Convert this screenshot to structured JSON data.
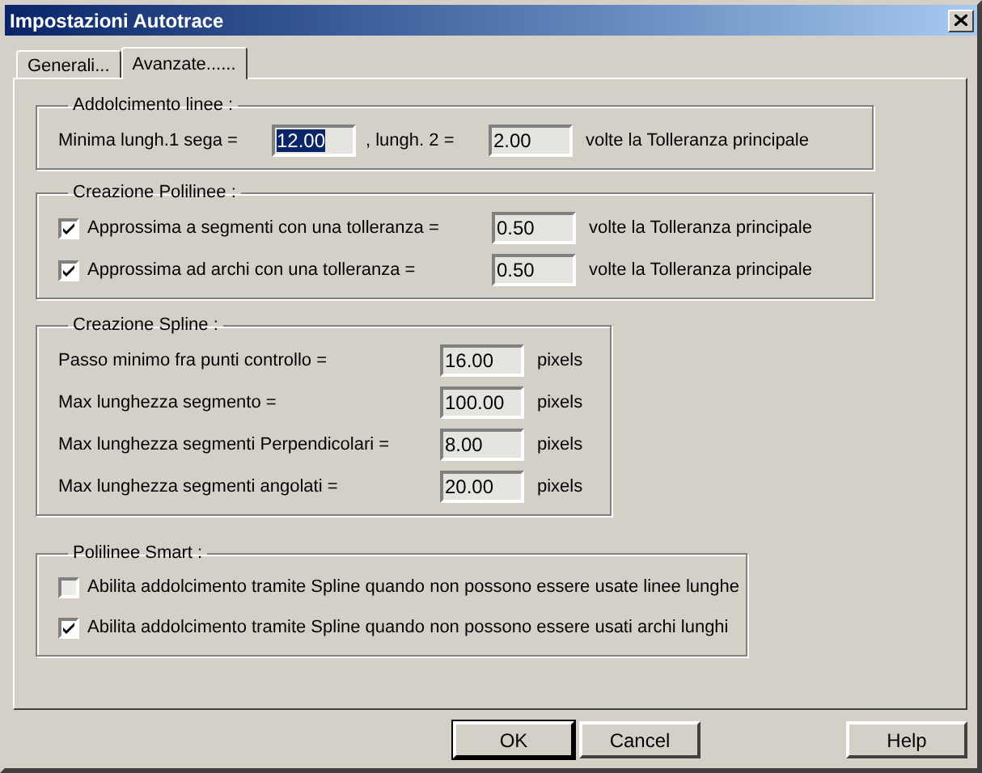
{
  "window": {
    "title": "Impostazioni Autotrace"
  },
  "tabs": [
    {
      "label": "Generali...",
      "selected": false
    },
    {
      "label": "Avanzate......",
      "selected": true
    }
  ],
  "groups": [
    {
      "title": "Addolcimento linee :",
      "rows": [
        {
          "kind": "pair",
          "label": "Minima lungh.1 sega =",
          "value": "12.00",
          "value_selected": true,
          "label_2": ", lungh. 2 =",
          "value_2": "2.00",
          "suffix": "volte la Tolleranza principale"
        }
      ]
    },
    {
      "title": "Creazione Polilinee :",
      "rows": [
        {
          "kind": "check_field",
          "label": "Approssima a segmenti con una tolleranza =",
          "checked": true,
          "value": "0.50",
          "suffix": "volte la Tolleranza principale"
        },
        {
          "kind": "check_field",
          "label": "Approssima ad archi con una tolleranza =",
          "checked": true,
          "value": "0.50",
          "suffix": "volte la Tolleranza principale"
        }
      ]
    },
    {
      "title": "Creazione Spline :",
      "rows": [
        {
          "kind": "field",
          "label": "Passo minimo fra punti controllo =",
          "value": "16.00",
          "suffix": "pixels"
        },
        {
          "kind": "field",
          "label": "Max lunghezza segmento =",
          "value": "100.00",
          "suffix": "pixels"
        },
        {
          "kind": "field",
          "label": "Max lunghezza segmenti Perpendicolari =",
          "value": "8.00",
          "suffix": "pixels"
        },
        {
          "kind": "field",
          "label": "Max lunghezza segmenti angolati =",
          "value": "20.00",
          "suffix": "pixels"
        }
      ]
    },
    {
      "title": "Polilinee Smart :",
      "rows": [
        {
          "kind": "check",
          "label": "Abilita addolcimento tramite Spline quando non possono essere usate linee lunghe",
          "checked": false
        },
        {
          "kind": "check",
          "label": "Abilita addolcimento tramite Spline quando non possono essere usati archi lunghi",
          "checked": true
        }
      ]
    }
  ],
  "buttons": [
    {
      "label": "OK",
      "default": true
    },
    {
      "label": "Cancel",
      "default": false
    },
    {
      "label": "Help",
      "default": false
    }
  ]
}
